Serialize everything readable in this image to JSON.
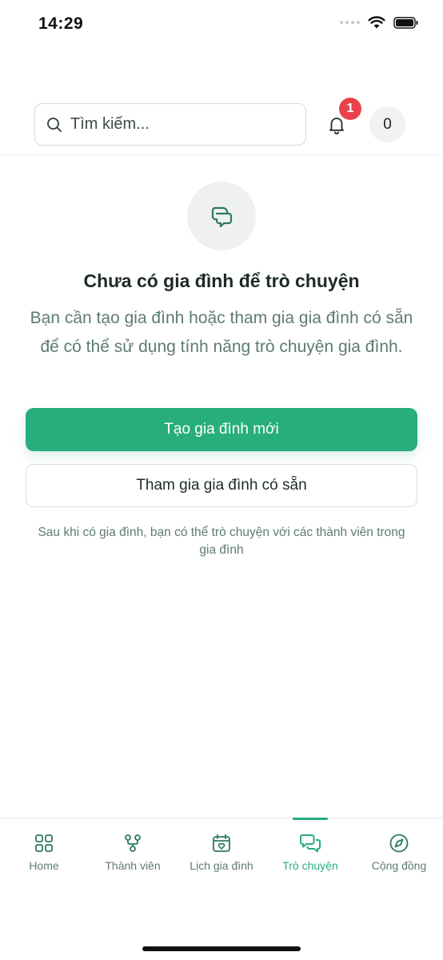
{
  "status_bar": {
    "time": "14:29"
  },
  "header": {
    "search_placeholder": "Tìm kiếm...",
    "notification_badge": "1",
    "count_value": "0"
  },
  "empty_state": {
    "title": "Chưa có gia đình để trò chuyện",
    "description": "Bạn cần tạo gia đình hoặc tham gia gia đình có sẵn để có thể sử dụng tính năng trò chuyện gia đình.",
    "primary_button": "Tạo gia đình mới",
    "secondary_button": "Tham gia gia đình có sẵn",
    "hint": "Sau khi có gia đình, bạn có thể trò chuyện với các thành viên trong gia đình"
  },
  "tabs": [
    {
      "label": "Home",
      "icon": "grid-icon",
      "active": false
    },
    {
      "label": "Thành viên",
      "icon": "members-tree-icon",
      "active": false
    },
    {
      "label": "Lịch gia đình",
      "icon": "calendar-heart-icon",
      "active": false
    },
    {
      "label": "Trò chuyện",
      "icon": "chat-bubbles-icon",
      "active": true
    },
    {
      "label": "Cộng đồng",
      "icon": "compass-icon",
      "active": false
    }
  ],
  "colors": {
    "accent": "#27ae7a",
    "badge": "#e8434c",
    "muted_text": "#5d7c70",
    "icon_stroke": "#2f7a5f"
  }
}
